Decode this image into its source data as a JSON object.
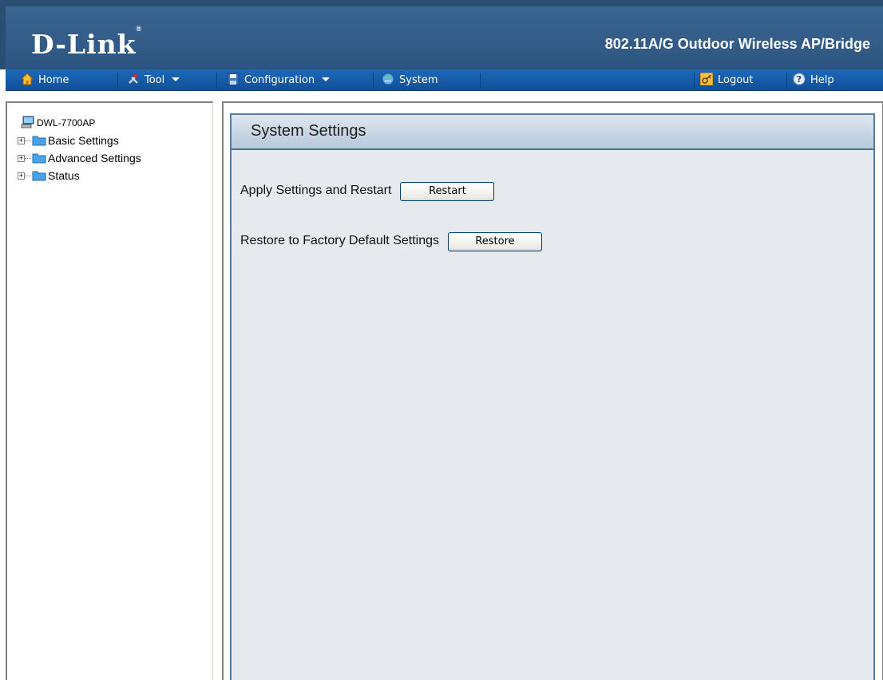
{
  "header": {
    "logo": "D-Link",
    "registered_mark": "®",
    "product": "802.11A/G Outdoor Wireless AP/Bridge"
  },
  "menu": {
    "home": "Home",
    "tool": "Tool",
    "configuration": "Configuration",
    "system": "System",
    "logout": "Logout",
    "help": "Help"
  },
  "tree": {
    "root": "DWL-7700AP",
    "items": [
      {
        "label": "Basic Settings"
      },
      {
        "label": "Advanced Settings"
      },
      {
        "label": "Status"
      }
    ]
  },
  "main": {
    "title": "System Settings",
    "apply_label": "Apply Settings and Restart",
    "restart_button": "Restart",
    "restore_label": "Restore to Factory Default Settings",
    "restore_button": "Restore"
  },
  "colors": {
    "header_bg": "#2d5580",
    "menubar_bg": "#1763b0",
    "content_bg": "#e6eaef",
    "title_bar": "#b6c8da"
  },
  "icons": {
    "home": "home-icon",
    "tool": "tool-icon",
    "configuration": "save-disk-icon",
    "system": "system-globe-icon",
    "logout": "key-icon",
    "help": "help-icon",
    "device": "computer-icon",
    "folder": "folder-icon"
  }
}
